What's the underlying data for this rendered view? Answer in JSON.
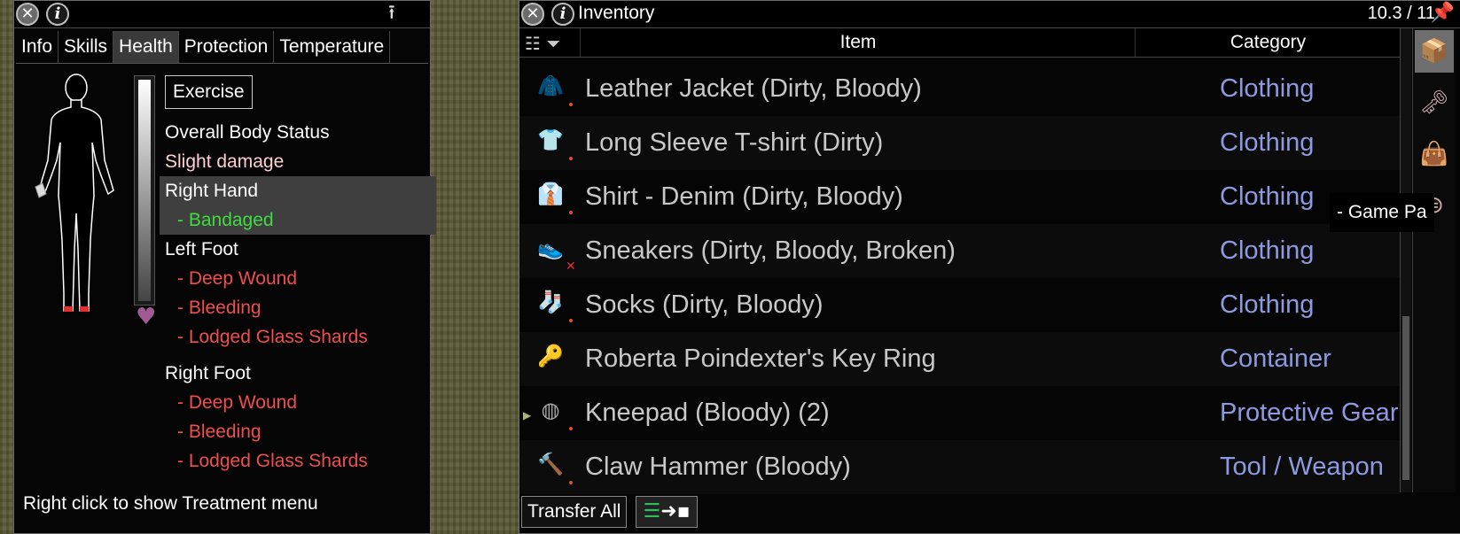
{
  "health_window": {
    "tabs": [
      "Info",
      "Skills",
      "Health",
      "Protection",
      "Temperature"
    ],
    "active_tab": "Health",
    "exercise_label": "Exercise",
    "status": [
      {
        "text": "Overall Body Status",
        "style": "head"
      },
      {
        "text": "Slight damage",
        "style": "light"
      },
      {
        "text": "Right Hand",
        "style": "head",
        "highlight": true
      },
      {
        "text": "- Bandaged",
        "style": "green",
        "highlight": true
      },
      {
        "text": "Left Foot",
        "style": "head"
      },
      {
        "text": "- Deep Wound",
        "style": "red"
      },
      {
        "text": "- Bleeding",
        "style": "red"
      },
      {
        "text": "- Lodged Glass Shards",
        "style": "red"
      },
      {
        "text": "Right Foot",
        "style": "head"
      },
      {
        "text": "- Deep Wound",
        "style": "red"
      },
      {
        "text": "- Bleeding",
        "style": "red"
      },
      {
        "text": "- Lodged Glass Shards",
        "style": "red"
      }
    ],
    "hint": "Right click to show Treatment menu",
    "health_level": 1.0
  },
  "inventory_window": {
    "title": "Inventory",
    "weight": "10.3 / 11",
    "columns": {
      "item": "Item",
      "category": "Category"
    },
    "items": [
      {
        "name": "Leather Jacket (Dirty, Bloody)",
        "category": "Clothing",
        "icon": "jacket-icon",
        "glyph": "🧥",
        "marker": "dot"
      },
      {
        "name": "Long Sleeve T-shirt (Dirty)",
        "category": "Clothing",
        "icon": "shirt-icon",
        "glyph": "👕",
        "marker": "dot"
      },
      {
        "name": "Shirt - Denim (Dirty, Bloody)",
        "category": "Clothing",
        "icon": "denim-shirt-icon",
        "glyph": "👔",
        "marker": "dot"
      },
      {
        "name": "Sneakers (Dirty, Bloody, Broken)",
        "category": "Clothing",
        "icon": "sneakers-icon",
        "glyph": "👟",
        "marker": "x"
      },
      {
        "name": "Socks (Dirty, Bloody)",
        "category": "Clothing",
        "icon": "socks-icon",
        "glyph": "🧦",
        "marker": "dot"
      },
      {
        "name": "Roberta Poindexter's Key Ring",
        "category": "Container",
        "icon": "key-ring-icon",
        "glyph": "🔑",
        "marker": ""
      },
      {
        "name": "Kneepad (Bloody) (2)",
        "category": "Protective Gear",
        "icon": "kneepad-icon",
        "glyph": "◍",
        "marker": "dot",
        "bullet": true
      },
      {
        "name": "Claw Hammer (Bloody)",
        "category": "Tool / Weapon",
        "icon": "hammer-icon",
        "glyph": "🔨",
        "marker": "dot"
      }
    ],
    "transfer_all": "Transfer All",
    "tooltip": "- Game Pa",
    "sidebar": [
      {
        "icon": "box-icon",
        "glyph": "📦",
        "selected": true
      },
      {
        "icon": "keys-icon",
        "glyph": "🗝"
      },
      {
        "icon": "bag-icon",
        "glyph": "👜"
      },
      {
        "icon": "fanny-pack-icon",
        "glyph": "⊜"
      }
    ]
  }
}
